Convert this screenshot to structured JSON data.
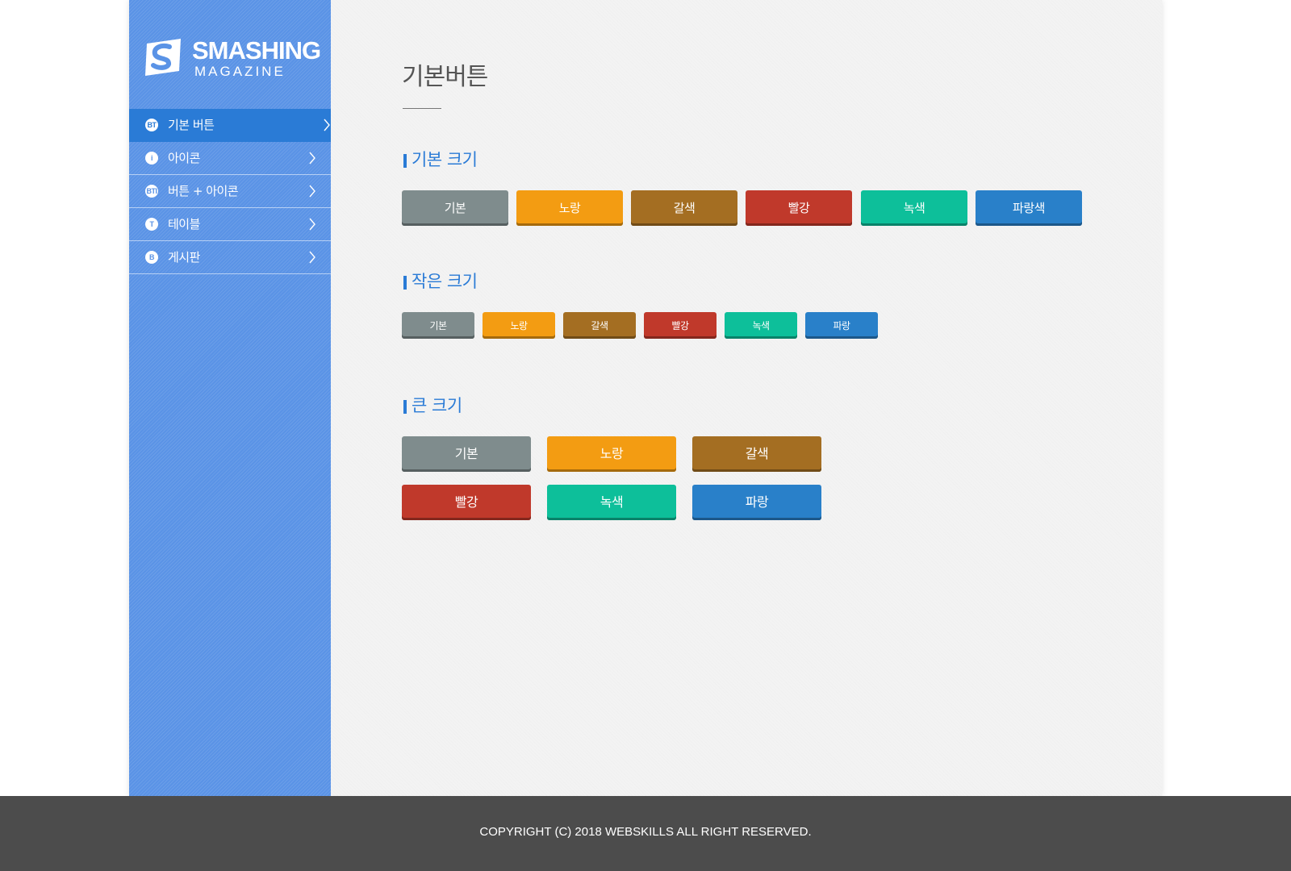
{
  "brand": {
    "name": "SMASHING",
    "sub": "MAGAZINE"
  },
  "sidebar": {
    "items": [
      {
        "icon": "BT",
        "label": "기본 버튼",
        "active": true
      },
      {
        "icon": "i",
        "label": "아이콘",
        "active": false
      },
      {
        "icon": "BTI",
        "label": "버튼 + 아이콘",
        "active": false
      },
      {
        "icon": "T",
        "label": "테이블",
        "active": false
      },
      {
        "icon": "B",
        "label": "게시판",
        "active": false
      }
    ]
  },
  "main": {
    "title": "기본버튼",
    "sections": [
      {
        "title": "기본 크기",
        "buttons": [
          "기본",
          "노랑",
          "갈색",
          "빨강",
          "녹색",
          "파랑색"
        ]
      },
      {
        "title": "작은 크기",
        "buttons": [
          "기본",
          "노랑",
          "갈색",
          "빨강",
          "녹색",
          "파랑"
        ]
      },
      {
        "title": "큰 크기",
        "buttons": [
          "기본",
          "노랑",
          "갈색",
          "빨강",
          "녹색",
          "파랑"
        ]
      }
    ]
  },
  "colors": {
    "gray": "#7f8c8d",
    "yellow": "#f39c12",
    "brown": "#a46e22",
    "red": "#c0392b",
    "green": "#0dbf9a",
    "blue": "#2980c9",
    "accent": "#2a7bd6",
    "sidebar": "#5a93e6"
  },
  "footer": {
    "text": "COPYRIGHT (C) 2018 WEBSKILLS ALL RIGHT RESERVED."
  }
}
